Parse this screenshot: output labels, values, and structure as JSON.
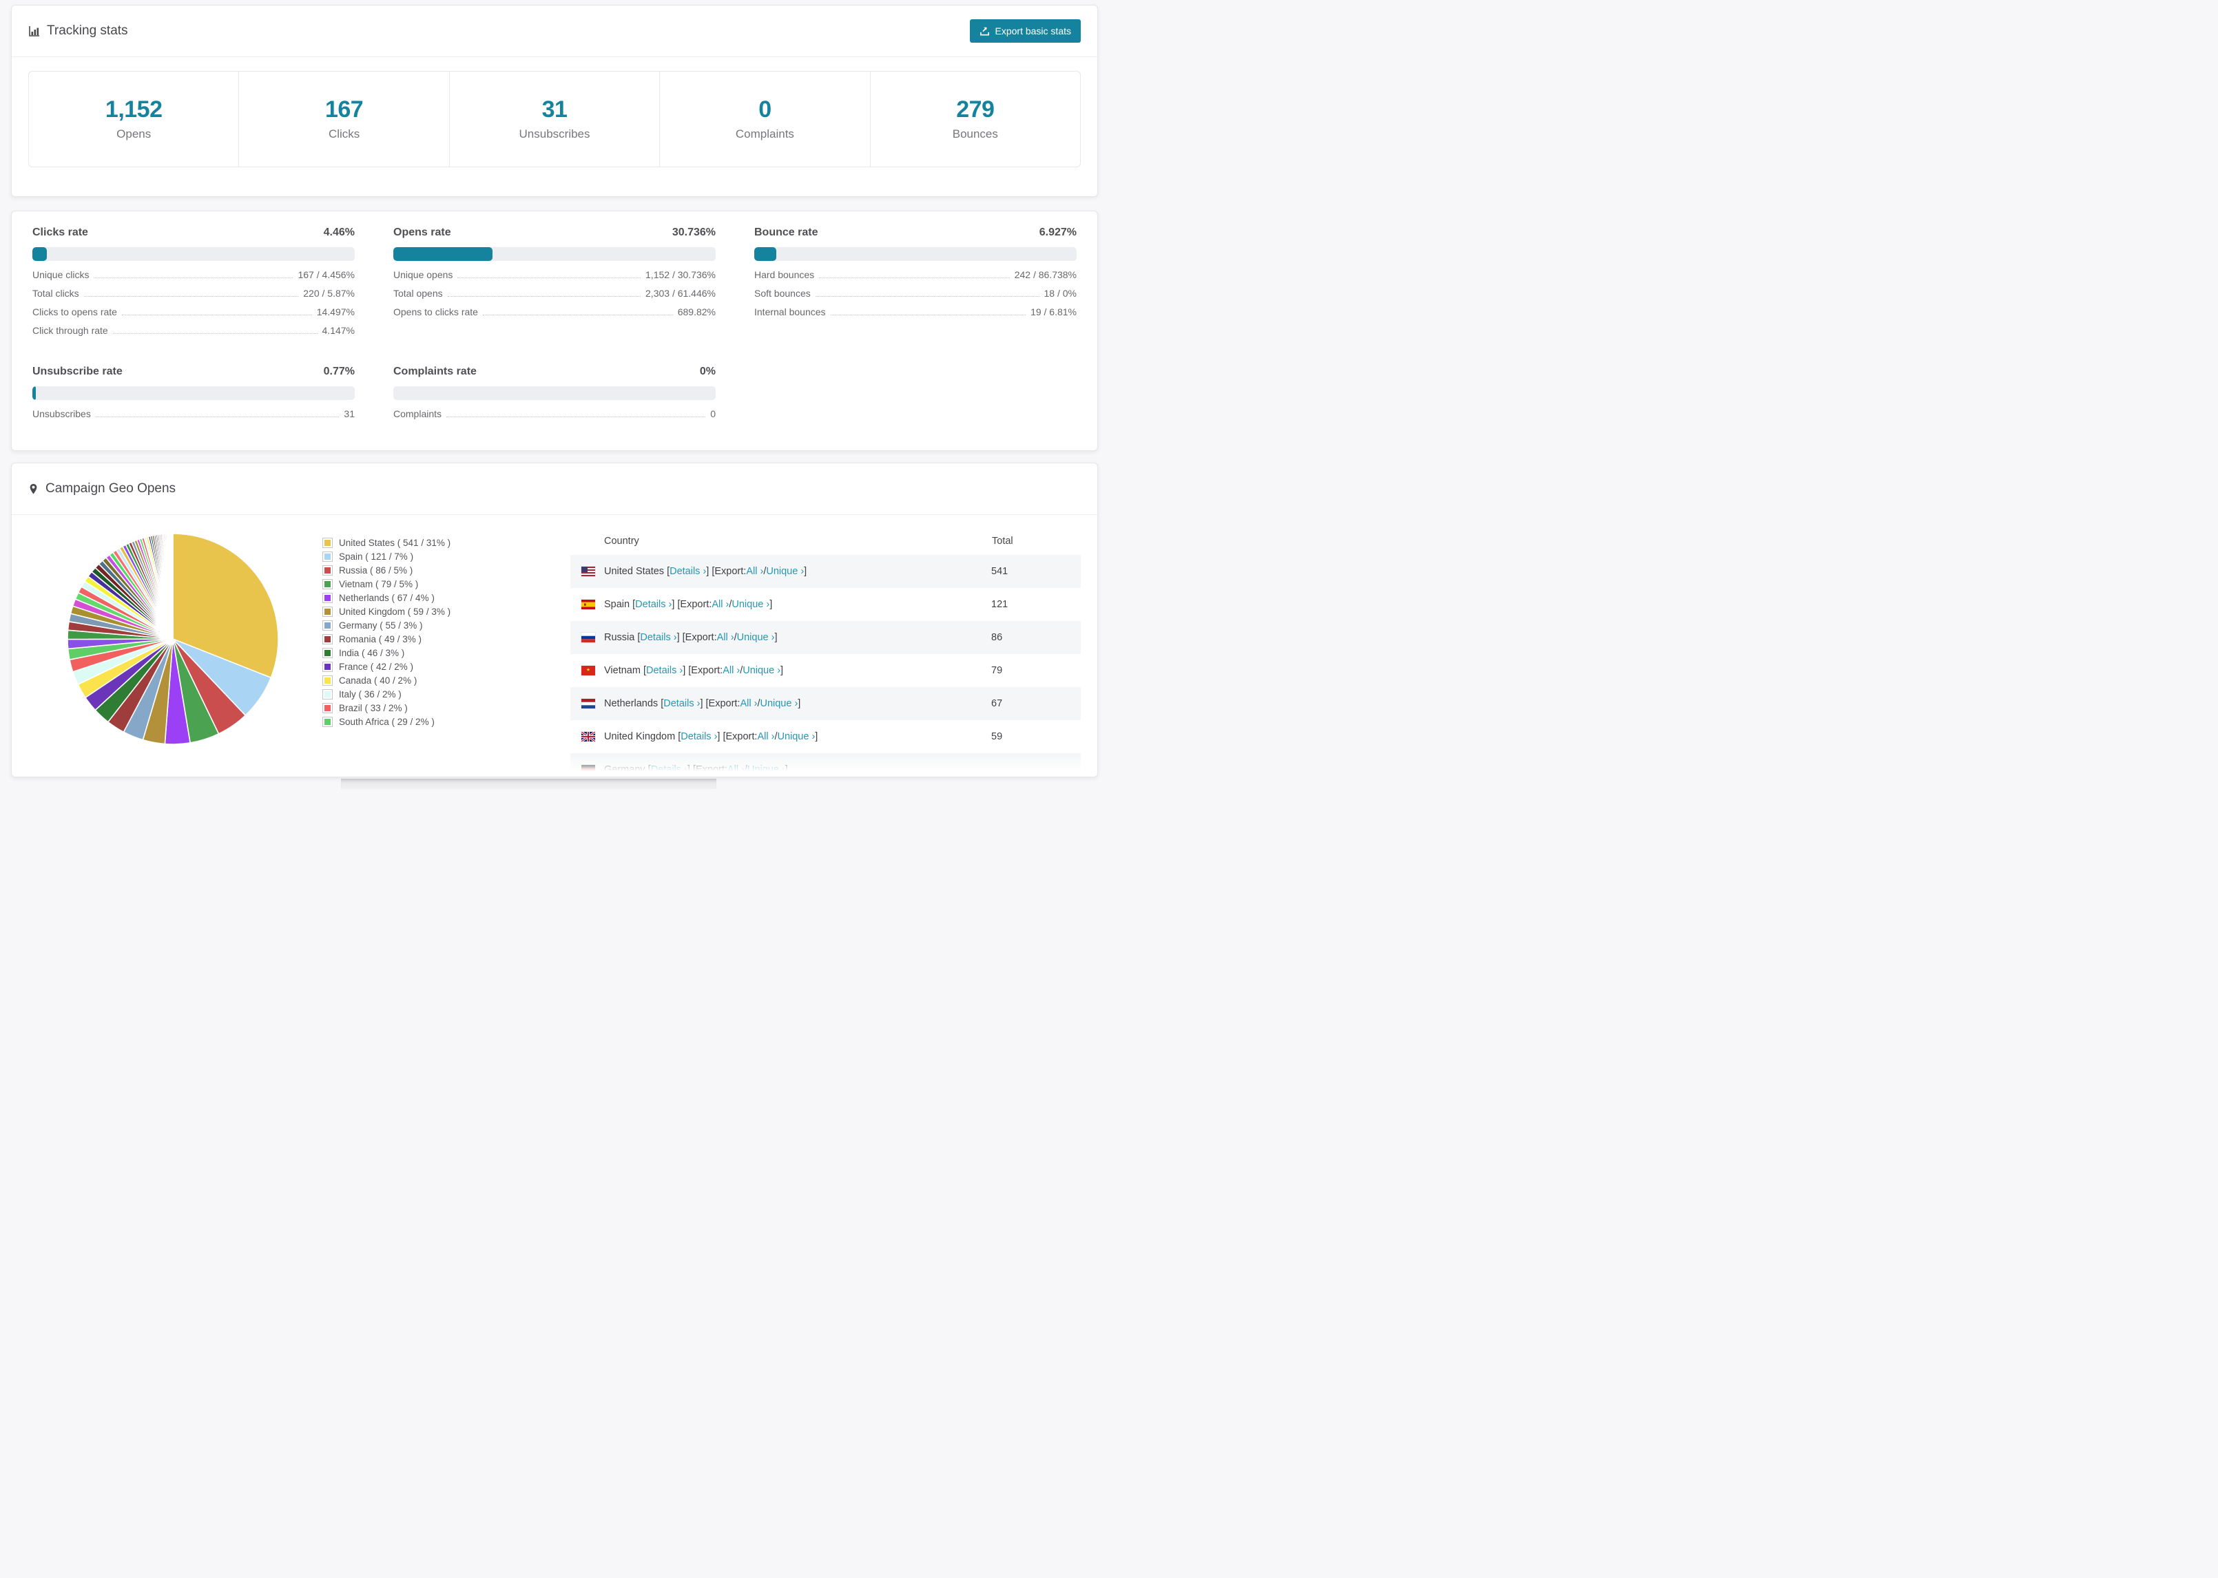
{
  "accent": "#15839e",
  "link_color": "#2597b4",
  "tracking": {
    "title": "Tracking stats",
    "export_button": "Export basic stats",
    "stats": [
      {
        "value": "1,152",
        "label": "Opens"
      },
      {
        "value": "167",
        "label": "Clicks"
      },
      {
        "value": "31",
        "label": "Unsubscribes"
      },
      {
        "value": "0",
        "label": "Complaints"
      },
      {
        "value": "279",
        "label": "Bounces"
      }
    ]
  },
  "rates": [
    {
      "title": "Clicks rate",
      "value": "4.46%",
      "pct": 4.46,
      "rows": [
        {
          "label": "Unique clicks",
          "value": "167 / 4.456%"
        },
        {
          "label": "Total clicks",
          "value": "220 / 5.87%"
        },
        {
          "label": "Clicks to opens rate",
          "value": "14.497%"
        },
        {
          "label": "Click through rate",
          "value": "4.147%"
        }
      ]
    },
    {
      "title": "Opens rate",
      "value": "30.736%",
      "pct": 30.736,
      "rows": [
        {
          "label": "Unique opens",
          "value": "1,152 / 30.736%"
        },
        {
          "label": "Total opens",
          "value": "2,303 / 61.446%"
        },
        {
          "label": "Opens to clicks rate",
          "value": "689.82%"
        }
      ]
    },
    {
      "title": "Bounce rate",
      "value": "6.927%",
      "pct": 6.927,
      "rows": [
        {
          "label": "Hard bounces",
          "value": "242 / 86.738%"
        },
        {
          "label": "Soft bounces",
          "value": "18 / 0%"
        },
        {
          "label": "Internal bounces",
          "value": "19 / 6.81%"
        }
      ]
    },
    {
      "title": "Unsubscribe rate",
      "value": "0.77%",
      "pct": 0.77,
      "rows": [
        {
          "label": "Unsubscribes",
          "value": "31"
        }
      ]
    },
    {
      "title": "Complaints rate",
      "value": "0%",
      "pct": 0,
      "rows": [
        {
          "label": "Complaints",
          "value": "0"
        }
      ]
    }
  ],
  "geo": {
    "title": "Campaign Geo Opens",
    "table": {
      "headers": [
        "Country",
        "Total"
      ],
      "punctuation": {
        "open": "[",
        "close": "]",
        "slash": " / ",
        "export_label": "Export: "
      },
      "links": {
        "details": "Details ›",
        "all": "All ›",
        "unique": "Unique ›"
      },
      "rows": [
        {
          "country": "United States",
          "flag": "us",
          "total": "541"
        },
        {
          "country": "Spain",
          "flag": "es",
          "total": "121"
        },
        {
          "country": "Russia",
          "flag": "ru",
          "total": "86"
        },
        {
          "country": "Vietnam",
          "flag": "vn",
          "total": "79"
        },
        {
          "country": "Netherlands",
          "flag": "nl",
          "total": "67"
        },
        {
          "country": "United Kingdom",
          "flag": "gb",
          "total": "59"
        },
        {
          "country": "Germany",
          "flag": "de",
          "total": "",
          "partial": true
        }
      ]
    }
  },
  "chart_data": {
    "type": "pie",
    "title": "Campaign Geo Opens",
    "labels": [
      "United States",
      "Spain",
      "Russia",
      "Vietnam",
      "Netherlands",
      "United Kingdom",
      "Germany",
      "Romania",
      "India",
      "France",
      "Canada",
      "Italy",
      "Brazil",
      "South Africa"
    ],
    "values": [
      541,
      121,
      86,
      79,
      67,
      59,
      55,
      49,
      46,
      42,
      40,
      36,
      33,
      29
    ],
    "legend_labels": [
      "United States ( 541 / 31% )",
      "Spain ( 121 / 7% )",
      "Russia ( 86 / 5% )",
      "Vietnam ( 79 / 5% )",
      "Netherlands ( 67 / 4% )",
      "United Kingdom ( 59 / 3% )",
      "Germany ( 55 / 3% )",
      "Romania ( 49 / 3% )",
      "India ( 46 / 3% )",
      "France ( 42 / 2% )",
      "Canada ( 40 / 2% )",
      "Italy ( 36 / 2% )",
      "Brazil ( 33 / 2% )",
      "South Africa ( 29 / 2% )"
    ],
    "colors": [
      "#e8c44c",
      "#aad4f3",
      "#cb4e4e",
      "#4ba250",
      "#9b40f5",
      "#b3913a",
      "#85a8c8",
      "#9e3d3b",
      "#2f7d35",
      "#6a35b8",
      "#fbe34d",
      "#dcfbf4",
      "#f15f5f",
      "#5fce66"
    ],
    "legend_position": "right",
    "others_unlabeled_approx_pct": 26.5,
    "start_angle_deg": 0,
    "direction": "clockwise"
  }
}
